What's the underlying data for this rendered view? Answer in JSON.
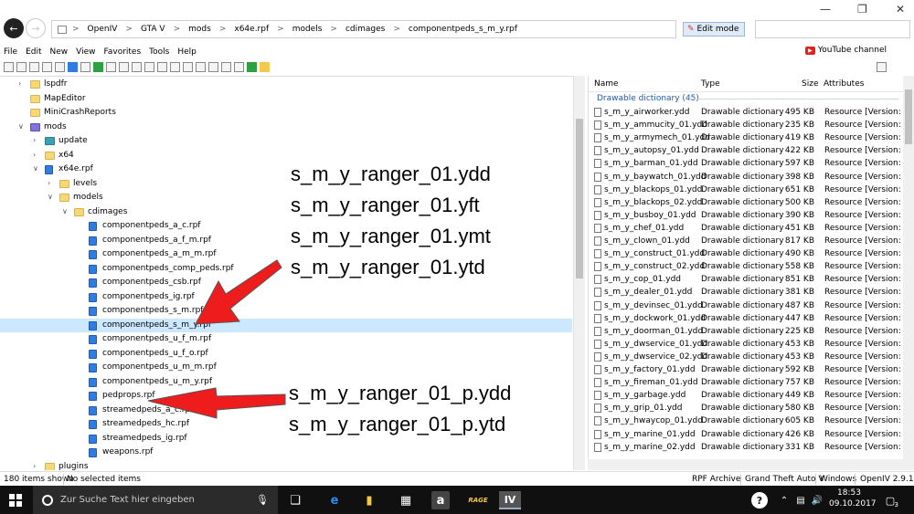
{
  "address": {
    "segments": [
      "OpenIV",
      "GTA V",
      "mods",
      "x64e.rpf",
      "models",
      "cdimages",
      "componentpeds_s_m_y.rpf"
    ],
    "separator": ">"
  },
  "edit_mode_label": "Edit mode",
  "menu": [
    "File",
    "Edit",
    "New",
    "View",
    "Favorites",
    "Tools",
    "Help"
  ],
  "youtube_label": "YouTube channel",
  "tree": [
    {
      "label": "lspdfr",
      "icon": "folder",
      "indent": 0,
      "chev": ">"
    },
    {
      "label": "MapEditor",
      "icon": "folder",
      "indent": 0,
      "chev": ""
    },
    {
      "label": "MiniCrashReports",
      "icon": "folder",
      "indent": 0,
      "chev": ""
    },
    {
      "label": "mods",
      "icon": "mods",
      "indent": 0,
      "chev": "v"
    },
    {
      "label": "update",
      "icon": "update",
      "indent": 1,
      "chev": ">"
    },
    {
      "label": "x64",
      "icon": "folder",
      "indent": 1,
      "chev": ">"
    },
    {
      "label": "x64e.rpf",
      "icon": "rpf",
      "indent": 1,
      "chev": "v"
    },
    {
      "label": "levels",
      "icon": "folder",
      "indent": 2,
      "chev": ">"
    },
    {
      "label": "models",
      "icon": "folder",
      "indent": 2,
      "chev": "v"
    },
    {
      "label": "cdimages",
      "icon": "folder",
      "indent": 3,
      "chev": "v"
    },
    {
      "label": "componentpeds_a_c.rpf",
      "icon": "rpf",
      "indent": 4,
      "chev": ""
    },
    {
      "label": "componentpeds_a_f_m.rpf",
      "icon": "rpf",
      "indent": 4,
      "chev": ""
    },
    {
      "label": "componentpeds_a_m_m.rpf",
      "icon": "rpf",
      "indent": 4,
      "chev": ""
    },
    {
      "label": "componentpeds_comp_peds.rpf",
      "icon": "rpf",
      "indent": 4,
      "chev": ""
    },
    {
      "label": "componentpeds_csb.rpf",
      "icon": "rpf",
      "indent": 4,
      "chev": ""
    },
    {
      "label": "componentpeds_ig.rpf",
      "icon": "rpf",
      "indent": 4,
      "chev": ""
    },
    {
      "label": "componentpeds_s_m.rpf",
      "icon": "rpf",
      "indent": 4,
      "chev": ""
    },
    {
      "label": "componentpeds_s_m_y.rpf",
      "icon": "rpf",
      "indent": 4,
      "chev": "",
      "selected": true
    },
    {
      "label": "componentpeds_u_f_m.rpf",
      "icon": "rpf",
      "indent": 4,
      "chev": ""
    },
    {
      "label": "componentpeds_u_f_o.rpf",
      "icon": "rpf",
      "indent": 4,
      "chev": ""
    },
    {
      "label": "componentpeds_u_m_m.rpf",
      "icon": "rpf",
      "indent": 4,
      "chev": ""
    },
    {
      "label": "componentpeds_u_m_y.rpf",
      "icon": "rpf",
      "indent": 4,
      "chev": ""
    },
    {
      "label": "pedprops.rpf",
      "icon": "rpf",
      "indent": 4,
      "chev": ""
    },
    {
      "label": "streamedpeds_a_c.rpf",
      "icon": "rpf",
      "indent": 4,
      "chev": ""
    },
    {
      "label": "streamedpeds_hc.rpf",
      "icon": "rpf",
      "indent": 4,
      "chev": ""
    },
    {
      "label": "streamedpeds_ig.rpf",
      "icon": "rpf",
      "indent": 4,
      "chev": ""
    },
    {
      "label": "weapons.rpf",
      "icon": "rpf",
      "indent": 4,
      "chev": ""
    },
    {
      "label": "plugins",
      "icon": "folder",
      "indent": 1,
      "chev": ">"
    }
  ],
  "overlay_text_top": [
    "s_m_y_ranger_01.ydd",
    "s_m_y_ranger_01.yft",
    "s_m_y_ranger_01.ymt",
    "s_m_y_ranger_01.ytd"
  ],
  "overlay_text_bottom": [
    "s_m_y_ranger_01_p.ydd",
    "s_m_y_ranger_01_p.ytd"
  ],
  "columns": {
    "name": "Name",
    "type": "Type",
    "size": "Size",
    "attributes": "Attributes"
  },
  "group_header": "Drawable dictionary (45)",
  "files": [
    {
      "name": "s_m_y_airworker.ydd",
      "type": "Drawable dictionary",
      "size": "495 KB",
      "attr": "Resource [Version: 165"
    },
    {
      "name": "s_m_y_ammucity_01.ydd",
      "type": "Drawable dictionary",
      "size": "235 KB",
      "attr": "Resource [Version: 165"
    },
    {
      "name": "s_m_y_armymech_01.ydd",
      "type": "Drawable dictionary",
      "size": "419 KB",
      "attr": "Resource [Version: 165"
    },
    {
      "name": "s_m_y_autopsy_01.ydd",
      "type": "Drawable dictionary",
      "size": "422 KB",
      "attr": "Resource [Version: 165"
    },
    {
      "name": "s_m_y_barman_01.ydd",
      "type": "Drawable dictionary",
      "size": "597 KB",
      "attr": "Resource [Version: 165"
    },
    {
      "name": "s_m_y_baywatch_01.ydd",
      "type": "Drawable dictionary",
      "size": "398 KB",
      "attr": "Resource [Version: 165"
    },
    {
      "name": "s_m_y_blackops_01.ydd",
      "type": "Drawable dictionary",
      "size": "651 KB",
      "attr": "Resource [Version: 165"
    },
    {
      "name": "s_m_y_blackops_02.ydd",
      "type": "Drawable dictionary",
      "size": "500 KB",
      "attr": "Resource [Version: 165"
    },
    {
      "name": "s_m_y_busboy_01.ydd",
      "type": "Drawable dictionary",
      "size": "390 KB",
      "attr": "Resource [Version: 165"
    },
    {
      "name": "s_m_y_chef_01.ydd",
      "type": "Drawable dictionary",
      "size": "451 KB",
      "attr": "Resource [Version: 165"
    },
    {
      "name": "s_m_y_clown_01.ydd",
      "type": "Drawable dictionary",
      "size": "817 KB",
      "attr": "Resource [Version: 165"
    },
    {
      "name": "s_m_y_construct_01.ydd",
      "type": "Drawable dictionary",
      "size": "490 KB",
      "attr": "Resource [Version: 165"
    },
    {
      "name": "s_m_y_construct_02.ydd",
      "type": "Drawable dictionary",
      "size": "558 KB",
      "attr": "Resource [Version: 165"
    },
    {
      "name": "s_m_y_cop_01.ydd",
      "type": "Drawable dictionary",
      "size": "851 KB",
      "attr": "Resource [Version: 165"
    },
    {
      "name": "s_m_y_dealer_01.ydd",
      "type": "Drawable dictionary",
      "size": "381 KB",
      "attr": "Resource [Version: 165"
    },
    {
      "name": "s_m_y_devinsec_01.ydd",
      "type": "Drawable dictionary",
      "size": "487 KB",
      "attr": "Resource [Version: 165"
    },
    {
      "name": "s_m_y_dockwork_01.ydd",
      "type": "Drawable dictionary",
      "size": "447 KB",
      "attr": "Resource [Version: 165"
    },
    {
      "name": "s_m_y_doorman_01.ydd",
      "type": "Drawable dictionary",
      "size": "225 KB",
      "attr": "Resource [Version: 165"
    },
    {
      "name": "s_m_y_dwservice_01.ydd",
      "type": "Drawable dictionary",
      "size": "453 KB",
      "attr": "Resource [Version: 165"
    },
    {
      "name": "s_m_y_dwservice_02.ydd",
      "type": "Drawable dictionary",
      "size": "453 KB",
      "attr": "Resource [Version: 165"
    },
    {
      "name": "s_m_y_factory_01.ydd",
      "type": "Drawable dictionary",
      "size": "592 KB",
      "attr": "Resource [Version: 165"
    },
    {
      "name": "s_m_y_fireman_01.ydd",
      "type": "Drawable dictionary",
      "size": "757 KB",
      "attr": "Resource [Version: 165"
    },
    {
      "name": "s_m_y_garbage.ydd",
      "type": "Drawable dictionary",
      "size": "449 KB",
      "attr": "Resource [Version: 165"
    },
    {
      "name": "s_m_y_grip_01.ydd",
      "type": "Drawable dictionary",
      "size": "580 KB",
      "attr": "Resource [Version: 165"
    },
    {
      "name": "s_m_y_hwaycop_01.ydd",
      "type": "Drawable dictionary",
      "size": "605 KB",
      "attr": "Resource [Version: 165"
    },
    {
      "name": "s_m_y_marine_01.ydd",
      "type": "Drawable dictionary",
      "size": "426 KB",
      "attr": "Resource [Version: 165"
    },
    {
      "name": "s_m_y_marine_02.ydd",
      "type": "Drawable dictionary",
      "size": "331 KB",
      "attr": "Resource [Version: 165"
    }
  ],
  "status": {
    "items_shown": "180 items shown",
    "selection": "No selected items",
    "archive": "RPF Archive",
    "game": "Grand Theft Auto V",
    "platform": "Windows",
    "version": "OpenIV 2.9.1"
  },
  "taskbar": {
    "search_placeholder": "Zur Suche Text hier eingeben",
    "time": "18:53",
    "date": "09.10.2017",
    "notifications": "3"
  }
}
